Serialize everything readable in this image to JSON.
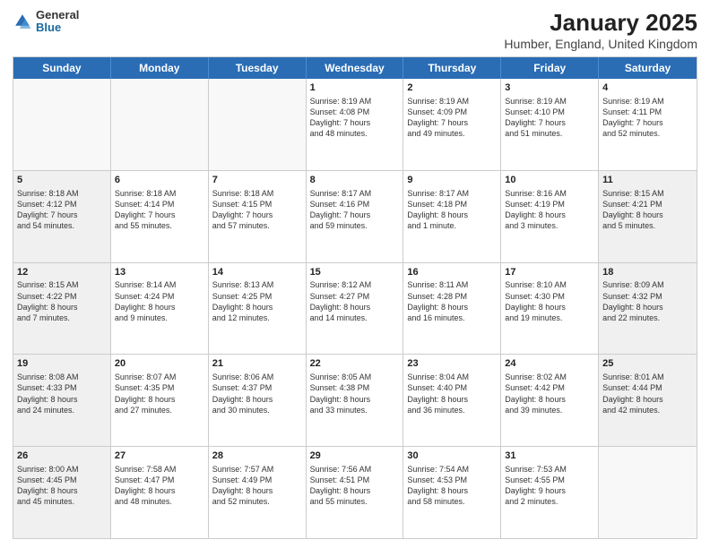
{
  "logo": {
    "general": "General",
    "blue": "Blue"
  },
  "header": {
    "title": "January 2025",
    "location": "Humber, England, United Kingdom"
  },
  "weekdays": [
    "Sunday",
    "Monday",
    "Tuesday",
    "Wednesday",
    "Thursday",
    "Friday",
    "Saturday"
  ],
  "weeks": [
    [
      {
        "day": "",
        "info": "",
        "shaded": true
      },
      {
        "day": "",
        "info": "",
        "shaded": true
      },
      {
        "day": "",
        "info": "",
        "shaded": true
      },
      {
        "day": "1",
        "info": "Sunrise: 8:19 AM\nSunset: 4:08 PM\nDaylight: 7 hours\nand 48 minutes.",
        "shaded": false
      },
      {
        "day": "2",
        "info": "Sunrise: 8:19 AM\nSunset: 4:09 PM\nDaylight: 7 hours\nand 49 minutes.",
        "shaded": false
      },
      {
        "day": "3",
        "info": "Sunrise: 8:19 AM\nSunset: 4:10 PM\nDaylight: 7 hours\nand 51 minutes.",
        "shaded": false
      },
      {
        "day": "4",
        "info": "Sunrise: 8:19 AM\nSunset: 4:11 PM\nDaylight: 7 hours\nand 52 minutes.",
        "shaded": false
      }
    ],
    [
      {
        "day": "5",
        "info": "Sunrise: 8:18 AM\nSunset: 4:12 PM\nDaylight: 7 hours\nand 54 minutes.",
        "shaded": true
      },
      {
        "day": "6",
        "info": "Sunrise: 8:18 AM\nSunset: 4:14 PM\nDaylight: 7 hours\nand 55 minutes.",
        "shaded": false
      },
      {
        "day": "7",
        "info": "Sunrise: 8:18 AM\nSunset: 4:15 PM\nDaylight: 7 hours\nand 57 minutes.",
        "shaded": false
      },
      {
        "day": "8",
        "info": "Sunrise: 8:17 AM\nSunset: 4:16 PM\nDaylight: 7 hours\nand 59 minutes.",
        "shaded": false
      },
      {
        "day": "9",
        "info": "Sunrise: 8:17 AM\nSunset: 4:18 PM\nDaylight: 8 hours\nand 1 minute.",
        "shaded": false
      },
      {
        "day": "10",
        "info": "Sunrise: 8:16 AM\nSunset: 4:19 PM\nDaylight: 8 hours\nand 3 minutes.",
        "shaded": false
      },
      {
        "day": "11",
        "info": "Sunrise: 8:15 AM\nSunset: 4:21 PM\nDaylight: 8 hours\nand 5 minutes.",
        "shaded": true
      }
    ],
    [
      {
        "day": "12",
        "info": "Sunrise: 8:15 AM\nSunset: 4:22 PM\nDaylight: 8 hours\nand 7 minutes.",
        "shaded": true
      },
      {
        "day": "13",
        "info": "Sunrise: 8:14 AM\nSunset: 4:24 PM\nDaylight: 8 hours\nand 9 minutes.",
        "shaded": false
      },
      {
        "day": "14",
        "info": "Sunrise: 8:13 AM\nSunset: 4:25 PM\nDaylight: 8 hours\nand 12 minutes.",
        "shaded": false
      },
      {
        "day": "15",
        "info": "Sunrise: 8:12 AM\nSunset: 4:27 PM\nDaylight: 8 hours\nand 14 minutes.",
        "shaded": false
      },
      {
        "day": "16",
        "info": "Sunrise: 8:11 AM\nSunset: 4:28 PM\nDaylight: 8 hours\nand 16 minutes.",
        "shaded": false
      },
      {
        "day": "17",
        "info": "Sunrise: 8:10 AM\nSunset: 4:30 PM\nDaylight: 8 hours\nand 19 minutes.",
        "shaded": false
      },
      {
        "day": "18",
        "info": "Sunrise: 8:09 AM\nSunset: 4:32 PM\nDaylight: 8 hours\nand 22 minutes.",
        "shaded": true
      }
    ],
    [
      {
        "day": "19",
        "info": "Sunrise: 8:08 AM\nSunset: 4:33 PM\nDaylight: 8 hours\nand 24 minutes.",
        "shaded": true
      },
      {
        "day": "20",
        "info": "Sunrise: 8:07 AM\nSunset: 4:35 PM\nDaylight: 8 hours\nand 27 minutes.",
        "shaded": false
      },
      {
        "day": "21",
        "info": "Sunrise: 8:06 AM\nSunset: 4:37 PM\nDaylight: 8 hours\nand 30 minutes.",
        "shaded": false
      },
      {
        "day": "22",
        "info": "Sunrise: 8:05 AM\nSunset: 4:38 PM\nDaylight: 8 hours\nand 33 minutes.",
        "shaded": false
      },
      {
        "day": "23",
        "info": "Sunrise: 8:04 AM\nSunset: 4:40 PM\nDaylight: 8 hours\nand 36 minutes.",
        "shaded": false
      },
      {
        "day": "24",
        "info": "Sunrise: 8:02 AM\nSunset: 4:42 PM\nDaylight: 8 hours\nand 39 minutes.",
        "shaded": false
      },
      {
        "day": "25",
        "info": "Sunrise: 8:01 AM\nSunset: 4:44 PM\nDaylight: 8 hours\nand 42 minutes.",
        "shaded": true
      }
    ],
    [
      {
        "day": "26",
        "info": "Sunrise: 8:00 AM\nSunset: 4:45 PM\nDaylight: 8 hours\nand 45 minutes.",
        "shaded": true
      },
      {
        "day": "27",
        "info": "Sunrise: 7:58 AM\nSunset: 4:47 PM\nDaylight: 8 hours\nand 48 minutes.",
        "shaded": false
      },
      {
        "day": "28",
        "info": "Sunrise: 7:57 AM\nSunset: 4:49 PM\nDaylight: 8 hours\nand 52 minutes.",
        "shaded": false
      },
      {
        "day": "29",
        "info": "Sunrise: 7:56 AM\nSunset: 4:51 PM\nDaylight: 8 hours\nand 55 minutes.",
        "shaded": false
      },
      {
        "day": "30",
        "info": "Sunrise: 7:54 AM\nSunset: 4:53 PM\nDaylight: 8 hours\nand 58 minutes.",
        "shaded": false
      },
      {
        "day": "31",
        "info": "Sunrise: 7:53 AM\nSunset: 4:55 PM\nDaylight: 9 hours\nand 2 minutes.",
        "shaded": false
      },
      {
        "day": "",
        "info": "",
        "shaded": true
      }
    ]
  ]
}
